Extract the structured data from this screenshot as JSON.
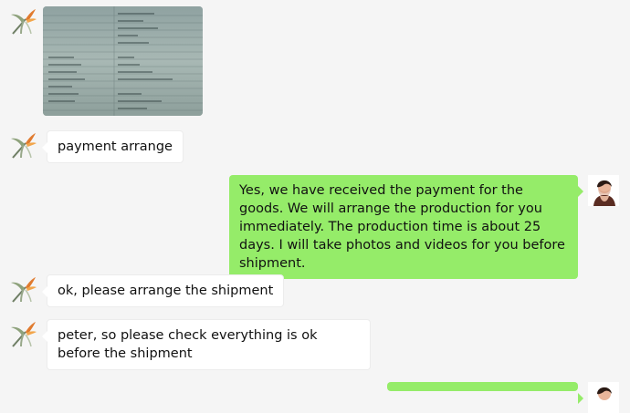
{
  "messages": [
    {
      "sender": "contact",
      "type": "image"
    },
    {
      "sender": "contact",
      "type": "text",
      "text": "payment arrange"
    },
    {
      "sender": "me",
      "type": "text",
      "text": "Yes, we have received the payment for the goods. We will arrange the production for you immediately. The production time is about 25 days. I will take photos and videos for you before shipment."
    },
    {
      "sender": "contact",
      "type": "text",
      "text": "ok, please arrange the shipment"
    },
    {
      "sender": "contact",
      "type": "text",
      "text": "peter, so please check everything is ok before the shipment"
    },
    {
      "sender": "me",
      "type": "text",
      "text": ""
    }
  ],
  "colors": {
    "background": "#f5f5f5",
    "incoming_bubble": "#ffffff",
    "outgoing_bubble": "#95ec69"
  },
  "icons": {
    "contact_avatar": "bird-of-paradise-flower-icon",
    "my_avatar": "person-avatar-icon"
  }
}
